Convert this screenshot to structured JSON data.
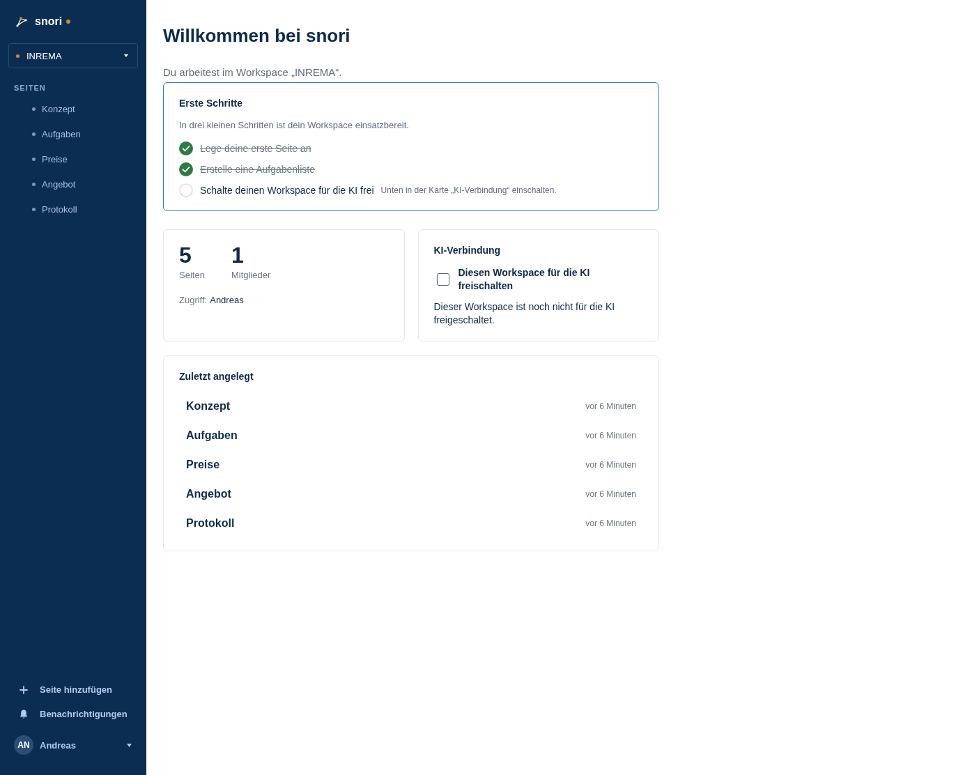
{
  "sidebar": {
    "brand": "snori",
    "workspace": {
      "name": "INREMA"
    },
    "section_label": "SEITEN",
    "pages": [
      {
        "label": "Konzept",
        "selected": false
      },
      {
        "label": "Aufgaben",
        "selected": false
      },
      {
        "label": "Preise",
        "selected": false
      },
      {
        "label": "Angebot",
        "selected": false
      },
      {
        "label": "Protokoll",
        "selected": false
      }
    ],
    "actions": [
      {
        "kind": "add",
        "label": "Seite hinzufügen"
      },
      {
        "kind": "notifications",
        "label": "Benachrichtigungen"
      }
    ],
    "user": {
      "initials": "AN",
      "name": "Andreas"
    }
  },
  "main": {
    "title": "Willkommen bei snori",
    "subtitle": "Du arbeitest im Workspace „INREMA“."
  },
  "getting_started": {
    "title": "Erste Schritte",
    "intro": "In drei kleinen Schritten ist dein Workspace einsatzbereit.",
    "steps": [
      {
        "label": "Lege deine erste Seite an",
        "done": true
      },
      {
        "label": "Erstelle eine Aufgabenliste",
        "done": true
      },
      {
        "label": "Schalte deinen Workspace für die KI frei",
        "done": false,
        "hint": "Unten in der Karte „KI-Verbindung“ einschalten."
      }
    ]
  },
  "stats": {
    "items": [
      {
        "value": "5",
        "label": "Seiten"
      },
      {
        "value": "1",
        "label": "Mitglieder"
      }
    ],
    "access_label": "Zugriff:",
    "access_value": "Andreas"
  },
  "ai_connection": {
    "title": "KI-Verbindung",
    "checkbox": {
      "label": "Diesen Workspace für die KI freischalten",
      "checked": false
    },
    "status_text": "Dieser Workspace ist noch nicht für die KI freigeschaltet."
  },
  "recent": {
    "title": "Zuletzt angelegt",
    "items": [
      {
        "title": "Konzept",
        "time": "vor 6 Minuten"
      },
      {
        "title": "Aufgaben",
        "time": "vor 6 Minuten"
      },
      {
        "title": "Preise",
        "time": "vor 6 Minuten"
      },
      {
        "title": "Angebot",
        "time": "vor 6 Minuten"
      },
      {
        "title": "Protokoll",
        "time": "vor 6 Minuten"
      }
    ]
  }
}
